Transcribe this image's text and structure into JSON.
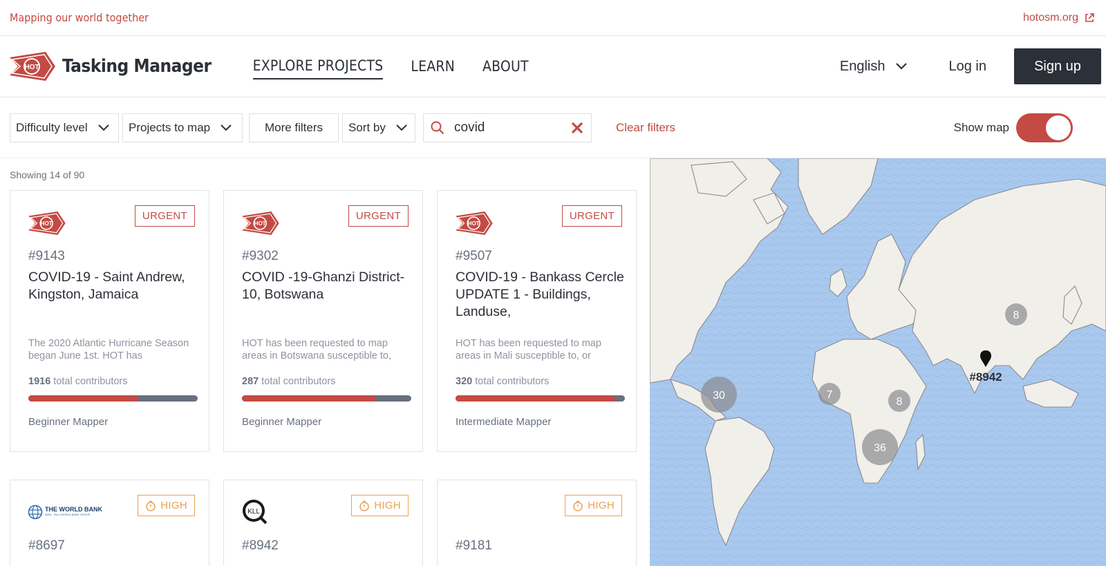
{
  "topbar": {
    "tagline": "Mapping our world together",
    "external_link": "hotosm.org"
  },
  "header": {
    "logo_text": "HOT",
    "brand": "Tasking Manager",
    "nav": [
      {
        "label": "EXPLORE PROJECTS",
        "active": true
      },
      {
        "label": "LEARN",
        "active": false
      },
      {
        "label": "ABOUT",
        "active": false
      }
    ],
    "language": "English",
    "login_label": "Log in",
    "signup_label": "Sign up"
  },
  "filters": {
    "difficulty_label": "Difficulty level",
    "projects_to_map_label": "Projects to map",
    "more_filters_label": "More filters",
    "sort_by_label": "Sort by",
    "search_value": "covid",
    "clear_filters_label": "Clear filters",
    "show_map_label": "Show map",
    "show_map_on": true
  },
  "results": {
    "showing_text": "Showing 14 of 90"
  },
  "projects": [
    {
      "org_logo": "HOT",
      "priority": "URGENT",
      "id": "#9143",
      "title": "COVID-19 - Saint Andrew, Kingston, Jamaica",
      "description": "The 2020 Atlantic Hurricane Season began June 1st. HOT has",
      "contributors_count": "1916",
      "contributors_label": "total contributors",
      "progress_mapped_fraction": 0.65,
      "difficulty": "Beginner Mapper"
    },
    {
      "org_logo": "HOT",
      "priority": "URGENT",
      "id": "#9302",
      "title": "COVID -19-Ghanzi District-10, Botswana",
      "description": "HOT has been requested to map areas in Botswana susceptible to,",
      "contributors_count": "287",
      "contributors_label": "total contributors",
      "progress_mapped_fraction": 0.79,
      "difficulty": "Beginner Mapper"
    },
    {
      "org_logo": "HOT",
      "priority": "URGENT",
      "id": "#9507",
      "title": "COVID-19 - Bankass Cercle UPDATE 1 - Buildings, Landuse,",
      "description": "HOT has been requested to map areas in Mali susceptible to, or",
      "contributors_count": "320",
      "contributors_label": "total contributors",
      "progress_mapped_fraction": 0.94,
      "difficulty": "Intermediate Mapper"
    },
    {
      "org_logo": "THE WORLD BANK",
      "org_logo_sub": "IBRD · IDA | WORLD BANK GROUP",
      "priority": "HIGH",
      "id": "#8697"
    },
    {
      "org_logo": "KLL",
      "priority": "HIGH",
      "id": "#8942"
    },
    {
      "org_logo": "",
      "priority": "HIGH",
      "id": "#9181"
    }
  ],
  "map": {
    "clusters": [
      "30",
      "7",
      "8",
      "36",
      "8"
    ],
    "pin_label": "#8942"
  },
  "colors": {
    "brand_red": "#c44a44",
    "dark": "#2c3038",
    "grey_text": "#68707f",
    "high_orange": "#e8a252",
    "ocean": "#a8c8ee"
  }
}
